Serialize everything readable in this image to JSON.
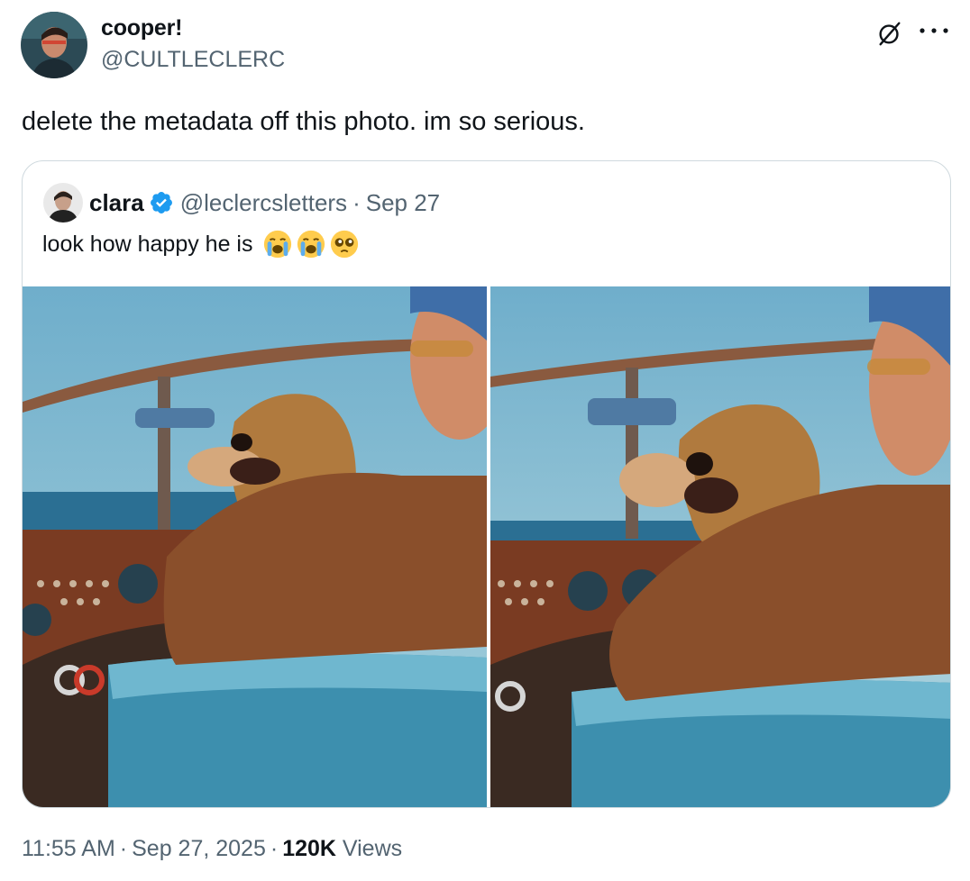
{
  "author": {
    "display_name": "cooper!",
    "handle": "@CULTLECLERC"
  },
  "tweet": {
    "text": "delete the metadata off this photo. im so serious."
  },
  "quoted_tweet": {
    "display_name": "clara",
    "handle": "@leclercsletters",
    "separator": "·",
    "date": "Sep 27",
    "text": "look how happy he is",
    "emojis": [
      "loudly-crying-face",
      "loudly-crying-face",
      "pleading-face"
    ],
    "verified_color": "#1d9bf0"
  },
  "icons": {
    "grok": "grok-icon",
    "more": "more-icon"
  },
  "meta": {
    "time": "11:55 AM",
    "separator": "·",
    "date": "Sep 27, 2025",
    "views_count": "120K",
    "views_label": "Views"
  }
}
